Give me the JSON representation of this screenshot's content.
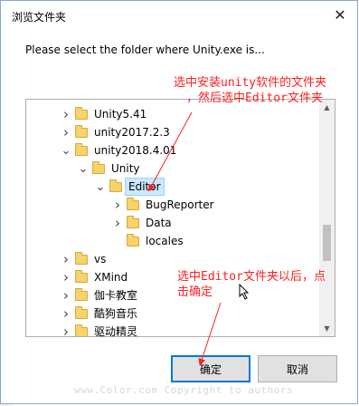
{
  "dialog": {
    "title": "浏览文件夹",
    "close_glyph": "✕",
    "prompt": "Please select the folder where Unity.exe is..."
  },
  "tree": {
    "items": [
      {
        "label": "Unity5.41",
        "expander": "collapsed",
        "level": 0
      },
      {
        "label": "unity2017.2.3",
        "expander": "collapsed",
        "level": 0
      },
      {
        "label": "unity2018.4.01",
        "expander": "expanded",
        "level": 0
      },
      {
        "label": "Unity",
        "expander": "expanded",
        "level": 1
      },
      {
        "label": "Editor",
        "expander": "expanded",
        "level": 2,
        "selected": true
      },
      {
        "label": "BugReporter",
        "expander": "collapsed",
        "level": 3
      },
      {
        "label": "Data",
        "expander": "collapsed",
        "level": 3
      },
      {
        "label": "locales",
        "expander": "none",
        "level": 3
      },
      {
        "label": "vs",
        "expander": "collapsed",
        "level": 0
      },
      {
        "label": "XMind",
        "expander": "collapsed",
        "level": 0
      },
      {
        "label": "伽卡教室",
        "expander": "collapsed",
        "level": 0
      },
      {
        "label": "酷狗音乐",
        "expander": "collapsed",
        "level": 0
      },
      {
        "label": "驱动精灵",
        "expander": "collapsed",
        "level": 0
      }
    ]
  },
  "buttons": {
    "ok": "确定",
    "cancel": "取消"
  },
  "annotations": {
    "top_line1": "选中安装unity软件的文件夹",
    "top_line2": "，然后选中Editor文件夹",
    "bottom_line1": "选中Editor文件夹以后，点",
    "bottom_line2": "击确定",
    "color": "#ff2020"
  },
  "watermark": "www.Color.com Copyright to authors",
  "colors": {
    "selection": "#cce8ff",
    "folder": "#f6d36b",
    "default_button_border": "#0078d7"
  }
}
